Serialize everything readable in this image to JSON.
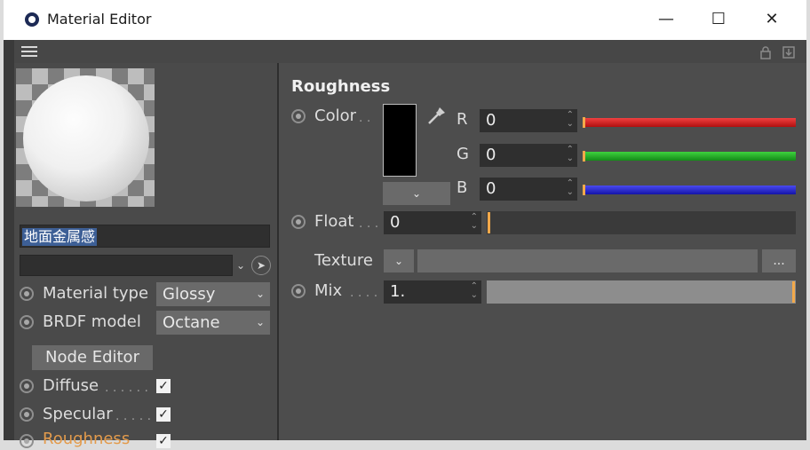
{
  "window": {
    "title": "Material Editor",
    "minimize_glyph": "—",
    "maximize_glyph": "☐",
    "close_glyph": "✕"
  },
  "toolbar": {
    "menu_icon": "hamburger-icon",
    "lock_icon": "lock-icon",
    "pin_icon": "pin-icon"
  },
  "left": {
    "material_name": "地面金属感",
    "material_type": {
      "label": "Material type",
      "value": "Glossy"
    },
    "brdf_model": {
      "label": "BRDF model",
      "value": "Octane"
    },
    "node_editor_label": "Node Editor",
    "channels": [
      {
        "label": "Diffuse",
        "dots": ". . . . . .",
        "checked": true
      },
      {
        "label": "Specular",
        "dots": ". . . . .",
        "checked": true
      },
      {
        "label": "Roughness",
        "checked": true,
        "color": "#e39b4c"
      }
    ]
  },
  "right": {
    "section_title": "Roughness",
    "color": {
      "label": "Color",
      "dots": ". .",
      "swatch_color": "#000000",
      "channels": [
        {
          "name": "R",
          "value": "0",
          "color": "#e02020"
        },
        {
          "name": "G",
          "value": "0",
          "color": "#22b024"
        },
        {
          "name": "B",
          "value": "0",
          "color": "#2a2ad0"
        }
      ]
    },
    "float": {
      "label": "Float",
      "dots": ". . .",
      "value": "0",
      "level": 0
    },
    "texture": {
      "label": "Texture",
      "more": "..."
    },
    "mix": {
      "label": "Mix",
      "dots": ". . . .",
      "value": "1.",
      "level": 1
    }
  }
}
